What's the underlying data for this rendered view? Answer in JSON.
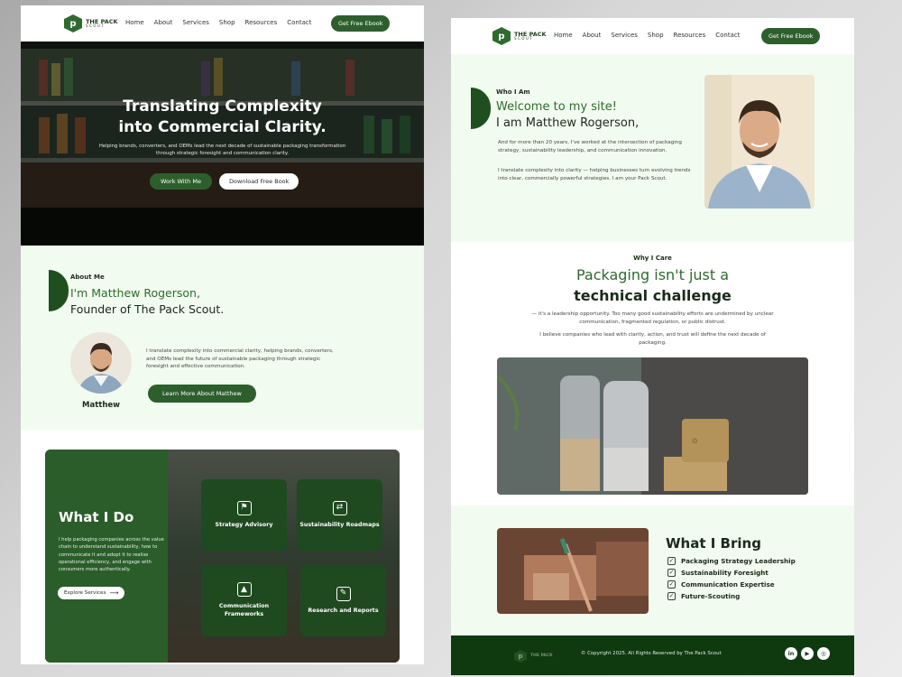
{
  "brand": {
    "line1": "THE PACK",
    "line2": "SCOUT"
  },
  "nav": {
    "items": [
      "Home",
      "About",
      "Services",
      "Shop",
      "Resources",
      "Contact"
    ],
    "cta": "Get Free Ebook"
  },
  "hero": {
    "title_line1": "Translating Complexity",
    "title_line2": "into Commercial Clarity.",
    "subtitle": "Helping brands, converters, and OEMs lead the next decade of sustainable packaging transformation through strategic foresight and communication clarity.",
    "primary_button": "Work With Me",
    "secondary_button": "Download Free Book"
  },
  "about": {
    "eyebrow": "About Me",
    "heading_line1": "I'm Matthew Rogerson,",
    "heading_line2": "Founder of The Pack Scout.",
    "avatar_name": "Matthew",
    "body": "I translate complexity into commercial clarity, helping brands, converters, and OEMs lead the future of sustainable packaging through strategic foresight and effective communication.",
    "button": "Learn More About Matthew"
  },
  "what_i_do": {
    "title": "What I Do",
    "body": "I help packaging companies across the value chain to understand sustainability, how to communicate it and adopt it to realise operational efficiency, and engage with consumers more authentically.",
    "button": "Explore Services",
    "cards": [
      {
        "label": "Strategy Advisory",
        "icon": "strategy-icon"
      },
      {
        "label": "Sustainability Roadmaps",
        "icon": "roadmap-icon"
      },
      {
        "label": "Communication Frameworks",
        "icon": "framework-icon"
      },
      {
        "label": "Research and Reports",
        "icon": "research-icon"
      }
    ]
  },
  "welcome": {
    "eyebrow": "Who I Am",
    "heading_green": "Welcome to my site!",
    "heading_dark": "I am Matthew Rogerson,",
    "para1": "And for more than 20 years, I've worked at the intersection of packaging strategy, sustainability leadership, and communication innovation.",
    "para2": "I translate complexity into clarity — helping businesses turn evolving trends into clear, commercially powerful strategies. I am your Pack Scout."
  },
  "why": {
    "eyebrow": "Why I Care",
    "heading_green": "Packaging isn't just a",
    "heading_dark": "technical challenge",
    "para1": "— it's a leadership opportunity. Too many good sustainability efforts are undermined by unclear communication, fragmented regulation, or public distrust.",
    "para2": "I believe companies who lead with clarity, action, and trust will define the next decade of packaging."
  },
  "bring": {
    "title": "What I Bring",
    "items": [
      "Packaging Strategy Leadership",
      "Sustainability Foresight",
      "Communication Expertise",
      "Future-Scouting"
    ]
  },
  "footer": {
    "copyright": "© Copyright 2025. All Rights Reserved by The Pack Scout",
    "social": [
      "linkedin-icon",
      "youtube-icon",
      "instagram-icon"
    ]
  },
  "colors": {
    "brand_green": "#2f6b2f",
    "dark_green": "#0f3a10",
    "mint": "#f2fbef"
  }
}
